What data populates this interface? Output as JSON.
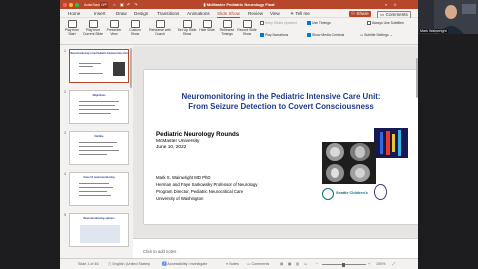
{
  "titlebar": {
    "autosave_label": "AutoSave",
    "autosave_state": "OFF",
    "doc_title": "McMaster Pediatric Neurology Final",
    "share_label": "Share",
    "comments_label": "Comments",
    "accent_color": "#b7472a"
  },
  "tabs": [
    {
      "label": "Home",
      "active": false
    },
    {
      "label": "Insert",
      "active": false
    },
    {
      "label": "Draw",
      "active": false
    },
    {
      "label": "Design",
      "active": false
    },
    {
      "label": "Transitions",
      "active": false
    },
    {
      "label": "Animations",
      "active": false
    },
    {
      "label": "Slide Show",
      "active": true
    },
    {
      "label": "Review",
      "active": false
    },
    {
      "label": "View",
      "active": false
    },
    {
      "label": "Tell me",
      "active": false
    }
  ],
  "ribbon": {
    "buttons": [
      {
        "label": "Play from Start"
      },
      {
        "label": "Play from Current Slide"
      },
      {
        "label": "Presenter View"
      },
      {
        "label": "Custom Show"
      },
      {
        "label": "Rehearse with Coach"
      },
      {
        "label": "Set Up Slide Show"
      },
      {
        "label": "Hide Slide"
      },
      {
        "label": "Rehearse Timings"
      },
      {
        "label": "Record Slide Show"
      }
    ],
    "options": {
      "keep_slides_updated": "Keep Slides Updated",
      "use_timings": "Use Timings",
      "play_narrations": "Play Narrations",
      "show_media_controls": "Show Media Controls",
      "always_use_subtitles": "Always Use Subtitles",
      "subtitle_settings": "Subtitle Settings"
    }
  },
  "thumbnails": [
    {
      "num": "1",
      "title": "Neuromonitoring in the Pediatric Intensive Care Unit",
      "selected": true
    },
    {
      "num": "2",
      "title": "Objectives",
      "selected": false
    },
    {
      "num": "3",
      "title": "Outline",
      "selected": false
    },
    {
      "num": "4",
      "title": "Case #1 neuromonitoring",
      "selected": false
    },
    {
      "num": "5",
      "title": "Neuromonitoring options",
      "selected": false
    }
  ],
  "slide": {
    "title_line1": "Neuromonitoring in the Pediatric Intensive Care Unit:",
    "title_line2": "From Seizure Detection to Covert Consciousness",
    "rounds": "Pediatric Neurology Rounds",
    "institution": "McMaster University",
    "date": "June 10, 2022",
    "author": "Mark S. Wainwright MD PhD",
    "chair": "Herman and Faye Sarkowsky Professor of Neurology",
    "program": "Program Director, Pediatric Neurocritical Care",
    "university": "University of Washington",
    "logo_hospital": "Seattle Children's",
    "title_color": "#1f3b8f"
  },
  "notes": {
    "placeholder": "Click to add notes"
  },
  "status": {
    "slide_count": "Slide 1 of 46",
    "language": "English (United States)",
    "accessibility": "Accessibility: Investigate",
    "notes_label": "Notes",
    "comments_label": "Comments",
    "zoom": "100%"
  },
  "video": {
    "participant_name": "Mark Wainwright"
  }
}
